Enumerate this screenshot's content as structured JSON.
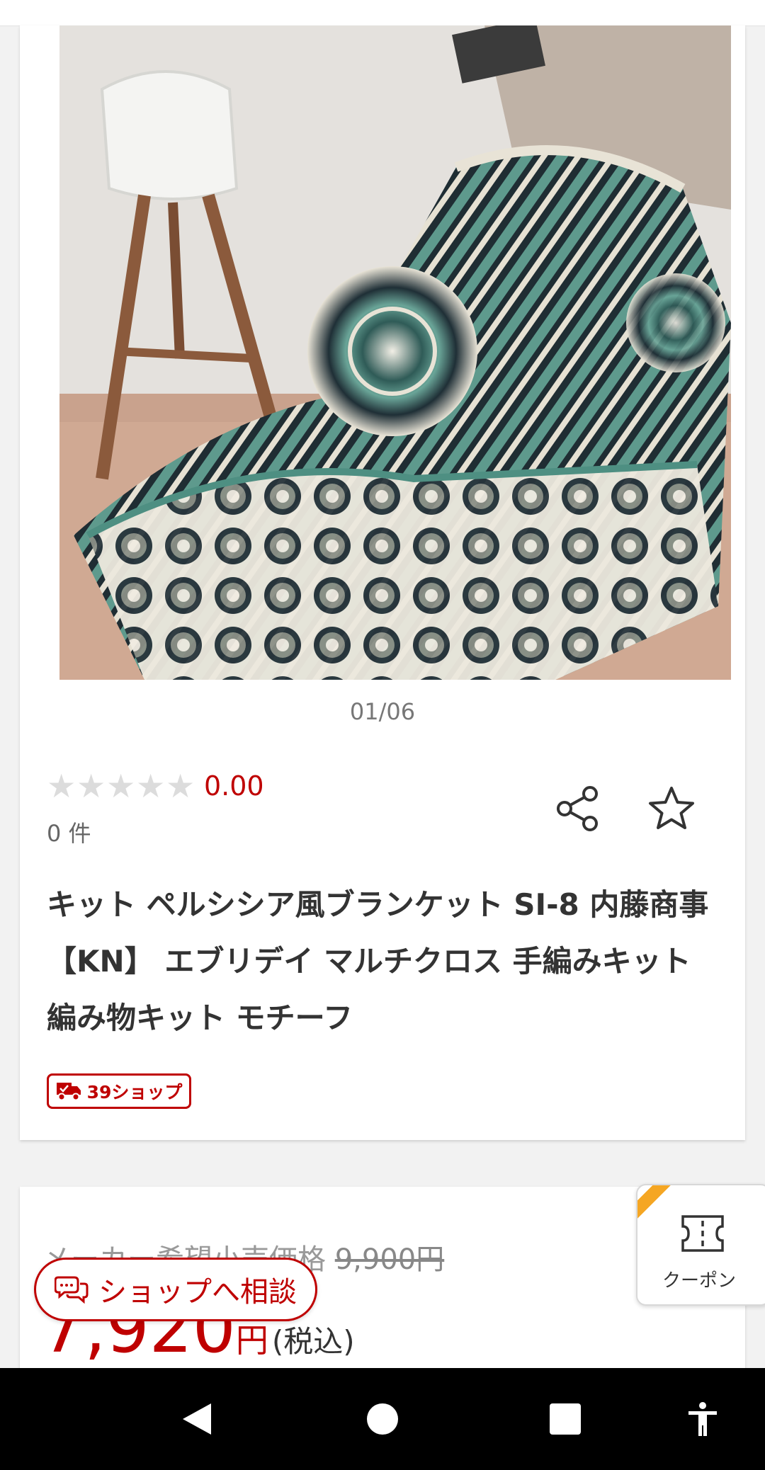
{
  "gallery": {
    "counter": "01/06",
    "image_alt": "ペルシア風ブランケット"
  },
  "rating": {
    "stars_filled": 0,
    "stars_total": 5,
    "value": "0.00",
    "count": "0 件"
  },
  "product": {
    "title": "キット ペルシシア風ブランケット SI-8 内藤商事【KN】 エブリデイ マルチクロス 手編みキット 編み物キット モチーフ",
    "badge": "39ショップ"
  },
  "pricing": {
    "msrp_label": "メーカー希望小売価格",
    "msrp_value": "9,900円",
    "price": "7,920",
    "currency": "円",
    "tax_note": "(税込)"
  },
  "actions": {
    "consult_label": "ショップへ相談",
    "coupon_label": "クーポン"
  },
  "colors": {
    "accent": "#bf0000",
    "coupon_corner": "#f5a623"
  },
  "icons": {
    "share": "share-icon",
    "favorite": "star-outline-icon",
    "truck": "truck-icon",
    "chat": "chat-bubbles-icon",
    "ticket": "ticket-icon",
    "back": "back-triangle-icon",
    "home": "home-circle-icon",
    "recents": "recents-square-icon",
    "accessibility": "accessibility-icon"
  }
}
